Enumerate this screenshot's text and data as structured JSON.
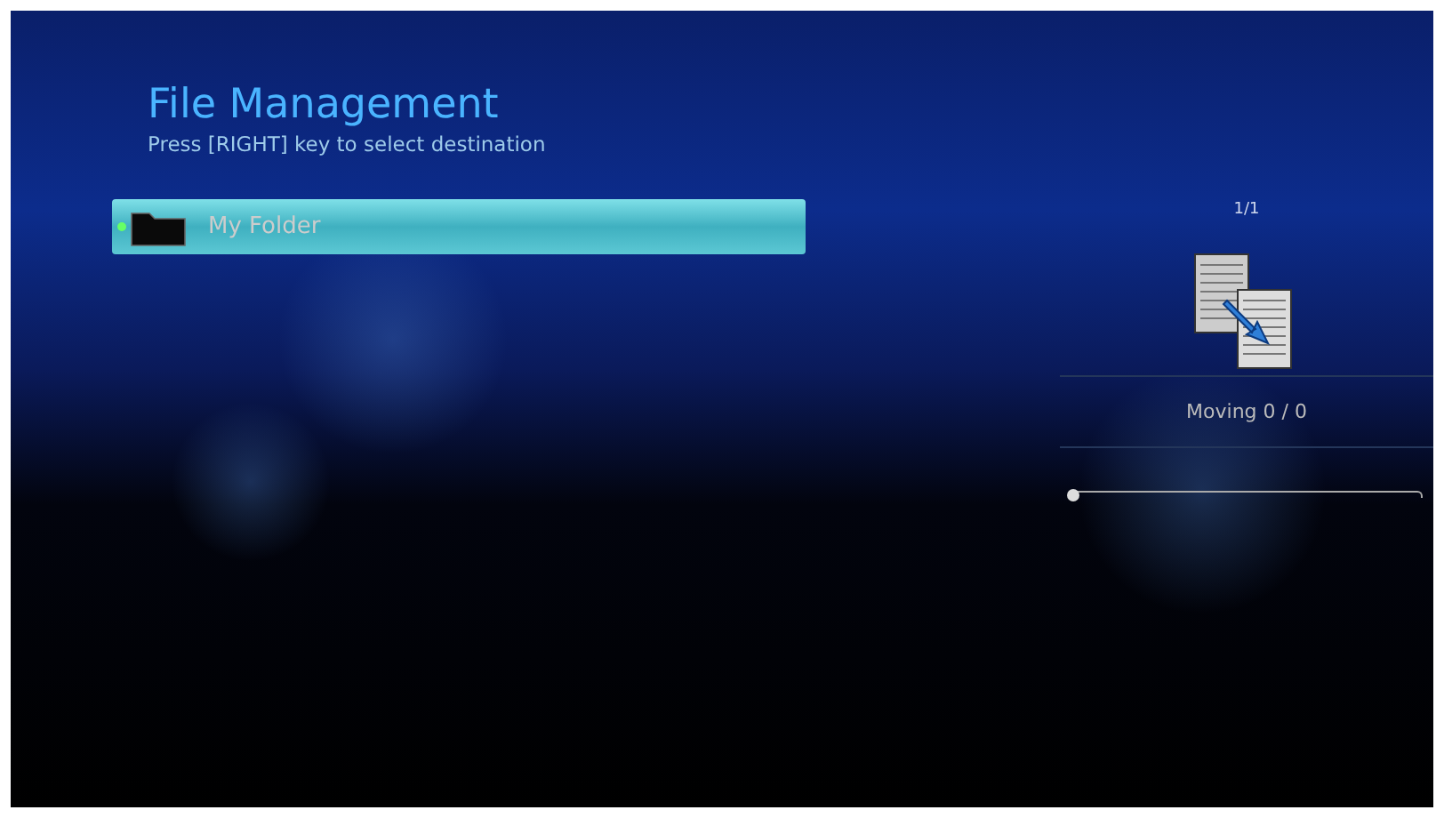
{
  "header": {
    "title": "File Management",
    "hint": "Press [RIGHT] key to select destination"
  },
  "folders": [
    {
      "name": "My Folder",
      "selected": true
    }
  ],
  "panel": {
    "page": "1/1",
    "status": "Moving 0 / 0",
    "progress": {
      "level": 0
    }
  }
}
